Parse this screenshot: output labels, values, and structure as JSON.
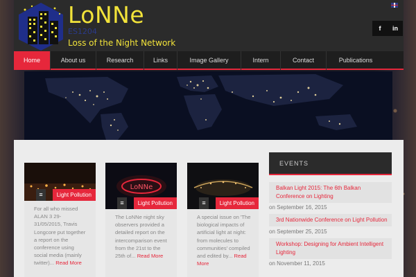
{
  "header": {
    "title": "LoNNe",
    "code": "ES1204",
    "subtitle": "Loss of the Night Network",
    "language_flag": "uk-flag-icon",
    "social": [
      {
        "label": "f",
        "icon": "facebook-icon"
      },
      {
        "label": "in",
        "icon": "linkedin-icon"
      }
    ]
  },
  "nav": {
    "items": [
      {
        "label": "Home",
        "active": true
      },
      {
        "label": "About us"
      },
      {
        "label": "Research"
      },
      {
        "label": "Links"
      },
      {
        "label": "Image Gallery"
      },
      {
        "label": "Intern"
      },
      {
        "label": "Contact"
      },
      {
        "label": "Publications"
      }
    ]
  },
  "posts": [
    {
      "tag": "Light Pollution",
      "text": "For all who missed ALAN 3 29-31/05/2015, Travis Longcore put together a report on the conference using social media (mainly twitter)...",
      "read_more": "Read More"
    },
    {
      "tag": "Light Pollution",
      "img_text": "LoNNe",
      "text": "The LoNNe night sky observers provided a detailed report on the intercomparison event from the 21st to the 25th of...",
      "read_more": "Read More"
    },
    {
      "tag": "Light Pollution",
      "text": "A special issue on 'The biological impacts of artificial light at night: from molecules to communities' compiled and edited by...",
      "read_more": "Read More"
    }
  ],
  "sidebar": {
    "heading": "EVENTS",
    "events": [
      {
        "title": "Balkan Light 2015: The 6th Balkan Conference on Lighting",
        "date": "on September 16, 2015"
      },
      {
        "title": "3rd Nationwide Conference on Light Pollution",
        "date": "on September 25, 2015"
      },
      {
        "title": "Workshop: Designing for Ambient Intelligent Lighting",
        "date": "on November 11, 2015"
      }
    ]
  },
  "colors": {
    "accent": "#e6273b",
    "logo_yellow": "#f2e33a",
    "header_bg": "#2b2b2b"
  }
}
